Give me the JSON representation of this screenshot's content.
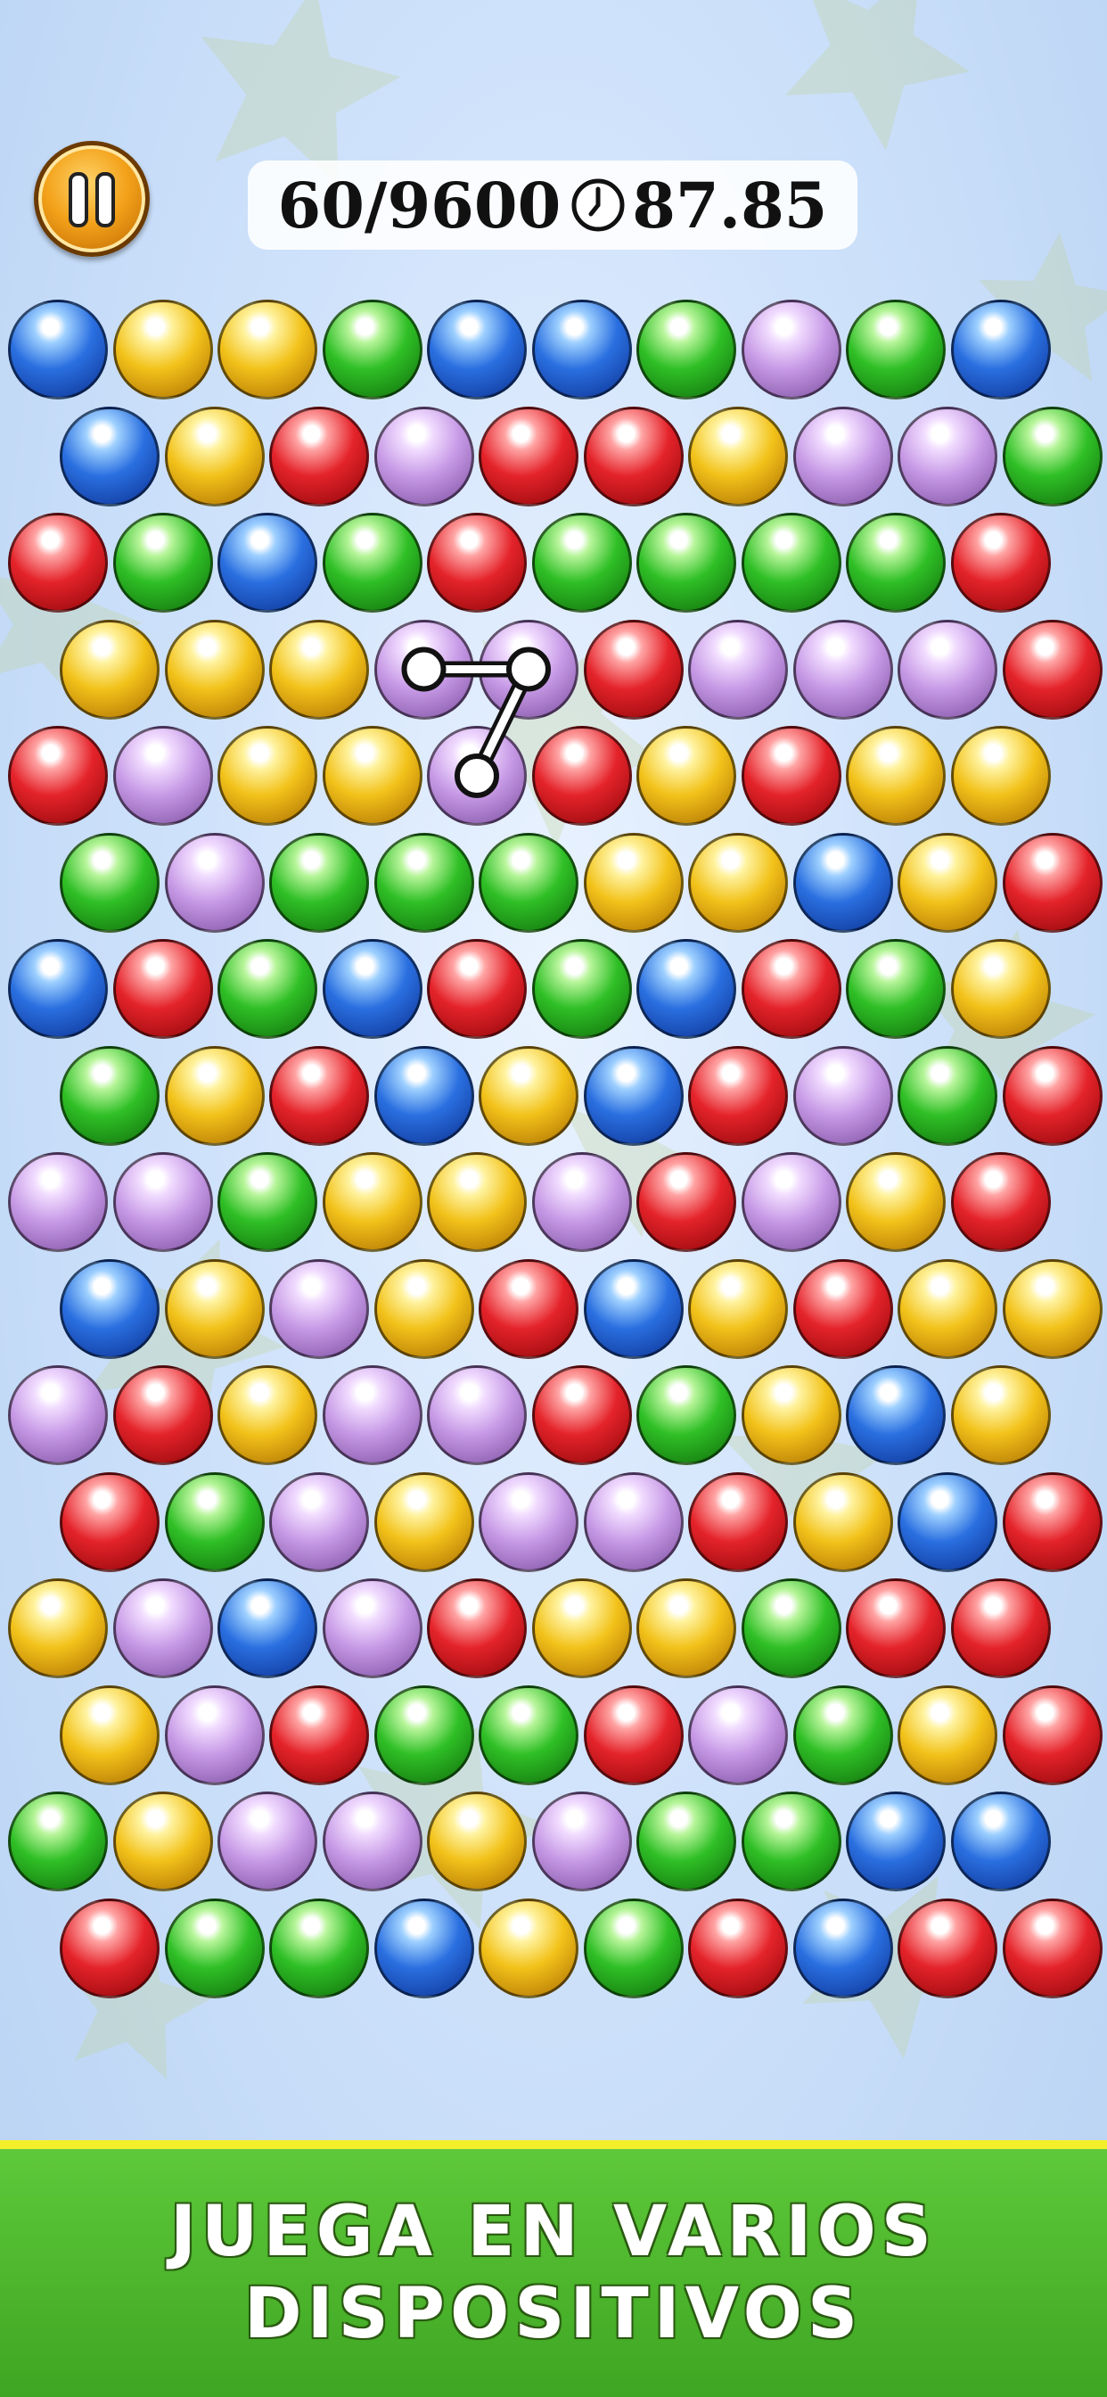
{
  "hud": {
    "score_text": "60/9600",
    "timer_text": "87.85",
    "pause_icon": "pause-icon",
    "clock_icon": "clock-icon"
  },
  "colors": {
    "blue": "#2a6fe0",
    "yellow": "#f2c21a",
    "green": "#2fbf26",
    "red": "#e4232a",
    "purple": "#c79ae6",
    "banner_green": "#4cb82c",
    "banner_border": "#f3ef2b"
  },
  "board": {
    "rows": [
      [
        "blue",
        "yellow",
        "yellow",
        "green",
        "blue",
        "blue",
        "green",
        "purple",
        "green",
        "blue"
      ],
      [
        "blue",
        "yellow",
        "red",
        "purple",
        "red",
        "red",
        "yellow",
        "purple",
        "purple",
        "green"
      ],
      [
        "red",
        "green",
        "blue",
        "green",
        "red",
        "green",
        "green",
        "green",
        "green",
        "red"
      ],
      [
        "yellow",
        "yellow",
        "yellow",
        "purple",
        "purple",
        "red",
        "purple",
        "purple",
        "purple",
        "red"
      ],
      [
        "red",
        "purple",
        "yellow",
        "yellow",
        "purple",
        "red",
        "yellow",
        "red",
        "yellow",
        "yellow"
      ],
      [
        "green",
        "purple",
        "green",
        "green",
        "green",
        "yellow",
        "yellow",
        "blue",
        "yellow",
        "red"
      ],
      [
        "blue",
        "red",
        "green",
        "blue",
        "red",
        "green",
        "blue",
        "red",
        "green",
        "yellow"
      ],
      [
        "green",
        "yellow",
        "red",
        "blue",
        "yellow",
        "blue",
        "red",
        "purple",
        "green",
        "red"
      ],
      [
        "purple",
        "purple",
        "green",
        "yellow",
        "yellow",
        "purple",
        "red",
        "purple",
        "yellow",
        "red"
      ],
      [
        "blue",
        "yellow",
        "purple",
        "yellow",
        "red",
        "blue",
        "yellow",
        "red",
        "yellow",
        "yellow"
      ],
      [
        "purple",
        "red",
        "yellow",
        "purple",
        "purple",
        "red",
        "green",
        "yellow",
        "blue",
        "yellow"
      ],
      [
        "red",
        "green",
        "purple",
        "yellow",
        "purple",
        "purple",
        "red",
        "yellow",
        "blue",
        "red"
      ],
      [
        "yellow",
        "purple",
        "blue",
        "purple",
        "red",
        "yellow",
        "yellow",
        "green",
        "red",
        "red"
      ],
      [
        "yellow",
        "purple",
        "red",
        "green",
        "green",
        "red",
        "purple",
        "green",
        "yellow",
        "red"
      ],
      [
        "green",
        "yellow",
        "purple",
        "purple",
        "yellow",
        "purple",
        "green",
        "green",
        "blue",
        "blue"
      ],
      [
        "red",
        "green",
        "green",
        "blue",
        "yellow",
        "green",
        "red",
        "blue",
        "red",
        "red"
      ]
    ],
    "selected_chain": [
      [
        3,
        3
      ],
      [
        3,
        4
      ],
      [
        4,
        4
      ]
    ]
  },
  "banner": {
    "line1": "JUEGA EN VARIOS",
    "line2": "DISPOSITIVOS"
  }
}
